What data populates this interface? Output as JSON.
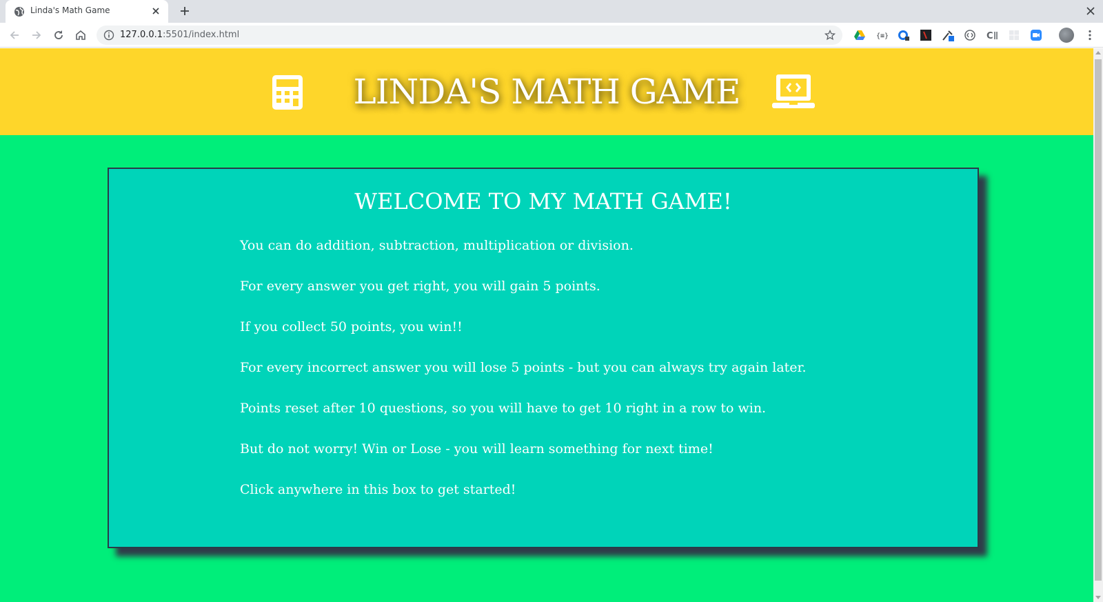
{
  "browser": {
    "tab_title": "Linda's Math Game",
    "url_host": "127.0.0.1",
    "url_rest": ":5501/index.html",
    "icons": [
      "globe-icon",
      "close-icon",
      "plus-icon",
      "back-icon",
      "forward-icon",
      "reload-icon",
      "home-icon",
      "info-icon",
      "star-icon",
      "menu-icon"
    ]
  },
  "page": {
    "title": "LINDA'S MATH GAME",
    "header_icons": [
      "calculator-icon",
      "laptop-code-icon"
    ],
    "card": {
      "heading": "WELCOME TO MY MATH GAME!",
      "rules": [
        "You can do addition, subtraction, multiplication or division.",
        "For every answer you get right, you will gain 5 points.",
        "If you collect 50 points, you win!!",
        "For every incorrect answer you will lose 5 points - but you can always try again later.",
        "Points reset after 10 questions, so you will have to get 10 right in a row to win.",
        "But do not worry! Win or Lose - you will learn something for next time!",
        "Click anywhere in this box to get started!"
      ]
    },
    "colors": {
      "header_bg": "#fed62a",
      "page_bg": "#00ee7a",
      "card_bg": "#00d4b9",
      "card_shadow": "#2f3d4a"
    }
  }
}
